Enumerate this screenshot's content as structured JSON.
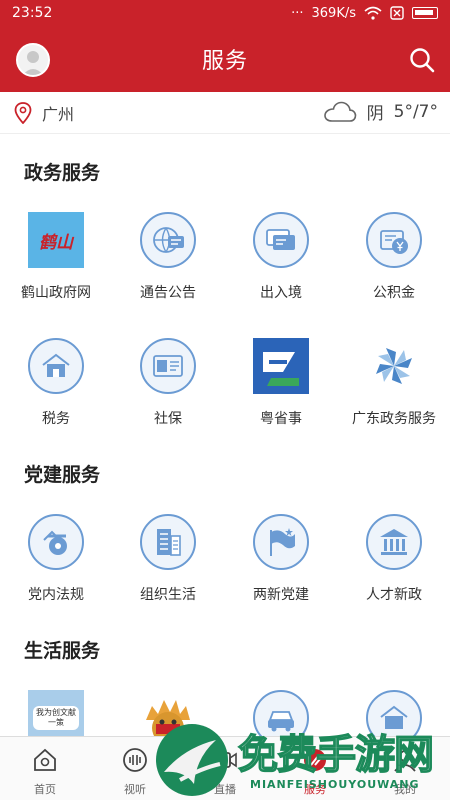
{
  "status": {
    "time": "23:52",
    "dots": "···",
    "speed": "369K/s"
  },
  "header": {
    "title": "服务"
  },
  "location": {
    "city": "广州",
    "weather": "阴",
    "temp": "5°/7°"
  },
  "sections": [
    {
      "title": "政务服务"
    },
    {
      "title": "党建服务"
    },
    {
      "title": "生活服务"
    }
  ],
  "gov_items": [
    {
      "label": "鹤山政府网",
      "icon": "heshan-logo-icon",
      "logo_text": "鹤山"
    },
    {
      "label": "通告公告",
      "icon": "announcement-icon"
    },
    {
      "label": "出入境",
      "icon": "passport-cards-icon"
    },
    {
      "label": "公积金",
      "icon": "fund-icon"
    },
    {
      "label": "税务",
      "icon": "tax-house-icon"
    },
    {
      "label": "社保",
      "icon": "social-security-card-icon"
    },
    {
      "label": "粤省事",
      "icon": "yueshengshi-app-icon"
    },
    {
      "label": "广东政务服务",
      "icon": "guangdong-gov-icon"
    }
  ],
  "party_items": [
    {
      "label": "党内法规",
      "icon": "whistle-icon"
    },
    {
      "label": "组织生活",
      "icon": "building-doc-icon"
    },
    {
      "label": "两新党建",
      "icon": "flag-icon"
    },
    {
      "label": "人才新政",
      "icon": "hall-icon"
    }
  ],
  "life_items": [
    {
      "icon": "poster-icon",
      "poster_text": "我为创文献一策"
    },
    {
      "icon": "lion-mascot-icon"
    },
    {
      "icon": "car-icon"
    },
    {
      "icon": "house-icon"
    }
  ],
  "tabs": [
    {
      "label": "首页",
      "icon": "home-icon"
    },
    {
      "label": "视听",
      "icon": "audio-icon"
    },
    {
      "label": "直播",
      "icon": "live-icon"
    },
    {
      "label": "服务",
      "icon": "service-icon",
      "active": true
    },
    {
      "label": "我的",
      "icon": "user-icon"
    }
  ],
  "watermark": {
    "cn": "免费手游网",
    "en": "MIANFEISHOUYOUWANG"
  },
  "colors": {
    "brand": "#c9222a",
    "icon_blue": "#6b9bd3",
    "icon_bg": "#eef4fb"
  }
}
